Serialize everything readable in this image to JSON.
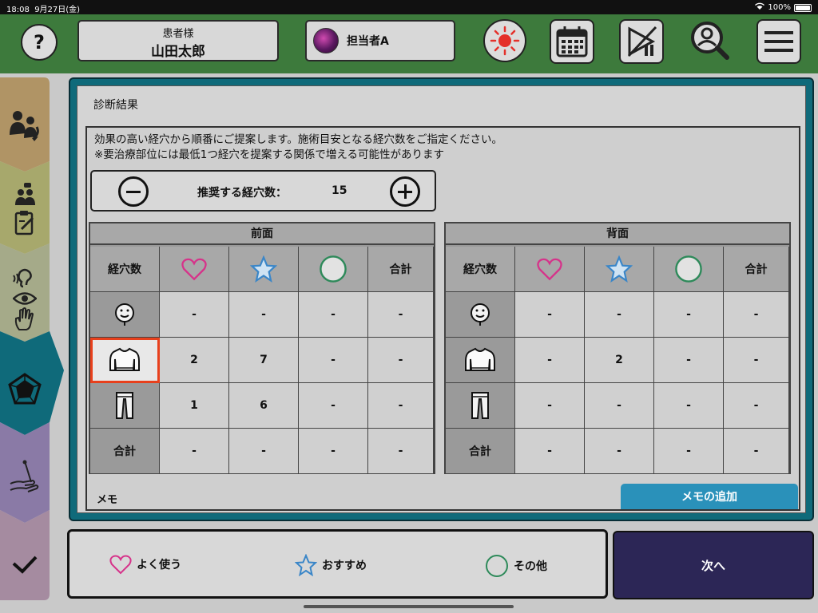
{
  "status_bar": {
    "time": "18:08",
    "date": "9月27日(金)",
    "battery": "100%"
  },
  "header": {
    "help_label": "?",
    "patient_caption": "患者様",
    "patient_name": "山田太郎",
    "staff_name": "担当者A"
  },
  "sidebar": {
    "items": [
      {
        "icon": "patient-transfer-icon",
        "color": "#b09465"
      },
      {
        "icon": "consultation-icon",
        "color": "#a7a86c"
      },
      {
        "icon": "senses-icon",
        "color": "#a5aa89"
      },
      {
        "icon": "pentagon-diagnosis-icon",
        "color": "#0f6a7a",
        "active": true
      },
      {
        "icon": "acupuncture-icon",
        "color": "#8a7aa6"
      },
      {
        "icon": "check-icon",
        "color": "#a58ba0"
      }
    ]
  },
  "main": {
    "section_title": "診断結果",
    "description_line1": "効果の高い経穴から順番にご提案します。施術目安となる経穴数をご指定ください。",
    "description_line2": "※要治療部位には最低1つ経穴を提案する関係で増える可能性があります",
    "counter": {
      "label": "推奨する経穴数：",
      "value": "15"
    },
    "tables": [
      {
        "title": "前面",
        "corner_label": "経穴数",
        "columns": [
          "heart-icon",
          "star-icon",
          "circle-icon",
          "合計"
        ],
        "rows": [
          {
            "icon": "face-icon",
            "cells": [
              "-",
              "-",
              "-",
              "-"
            ]
          },
          {
            "icon": "upper-body-icon",
            "cells": [
              "2",
              "7",
              "-",
              "-"
            ],
            "selected": true
          },
          {
            "icon": "lower-body-icon",
            "cells": [
              "1",
              "6",
              "-",
              "-"
            ]
          },
          {
            "label": "合計",
            "cells": [
              "-",
              "-",
              "-",
              "-"
            ]
          }
        ]
      },
      {
        "title": "背面",
        "corner_label": "経穴数",
        "columns": [
          "heart-icon",
          "star-icon",
          "circle-icon",
          "合計"
        ],
        "rows": [
          {
            "icon": "face-icon",
            "cells": [
              "-",
              "-",
              "-",
              "-"
            ]
          },
          {
            "icon": "upper-body-icon",
            "cells": [
              "-",
              "2",
              "-",
              "-"
            ]
          },
          {
            "icon": "lower-body-icon",
            "cells": [
              "-",
              "-",
              "-",
              "-"
            ]
          },
          {
            "label": "合計",
            "cells": [
              "-",
              "-",
              "-",
              "-"
            ]
          }
        ]
      }
    ],
    "memo_label": "メモ",
    "memo_add_button": "メモの追加"
  },
  "legend": {
    "frequent": "よく使う",
    "recommended": "おすすめ",
    "other": "その他"
  },
  "next_button": "次へ",
  "colors": {
    "header_green": "#3d7a3c",
    "main_teal": "#0f6a7a",
    "heart": "#d6338a",
    "star": "#3a86c8",
    "circle": "#2e8a5a",
    "selection": "#e8401c",
    "next_bg": "#2c2656",
    "memo_btn": "#2a91ba"
  }
}
